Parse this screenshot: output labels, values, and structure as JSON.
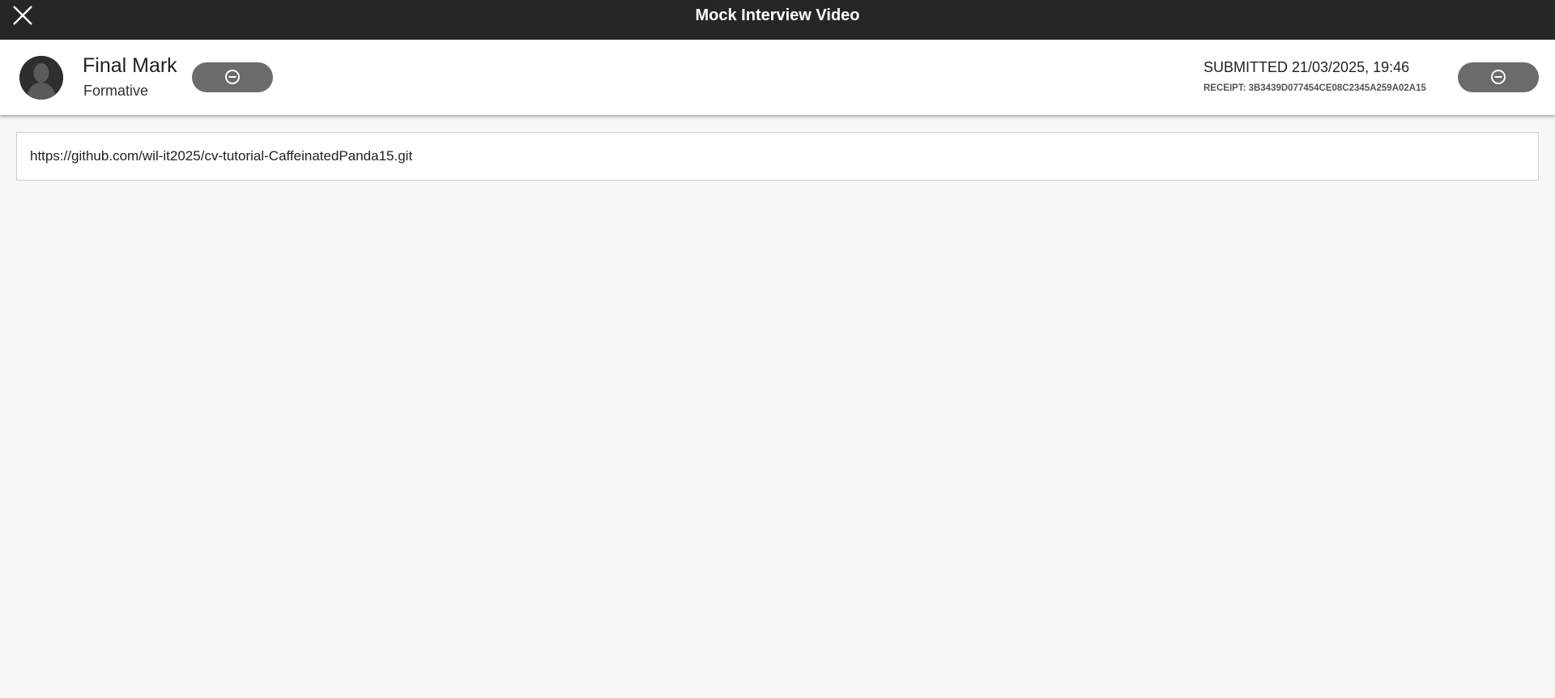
{
  "topbar": {
    "title": "Mock Interview Video",
    "close_icon": "close-icon",
    "background": "#262626"
  },
  "header": {
    "avatar_icon": "user-avatar-icon",
    "mark_title": "Final Mark",
    "mark_subtitle": "Formative",
    "left_button_icon": "minus-circle-icon",
    "submitted_text": "SUBMITTED 21/03/2025, 19:46",
    "receipt_text": "RECEIPT: 3B3439D077454CE08C2345A259A02A15",
    "right_button_icon": "minus-circle-icon",
    "button_color": "#6b6b6b"
  },
  "content": {
    "url": "https://github.com/wil-it2025/cv-tutorial-CaffeinatedPanda15.git"
  }
}
